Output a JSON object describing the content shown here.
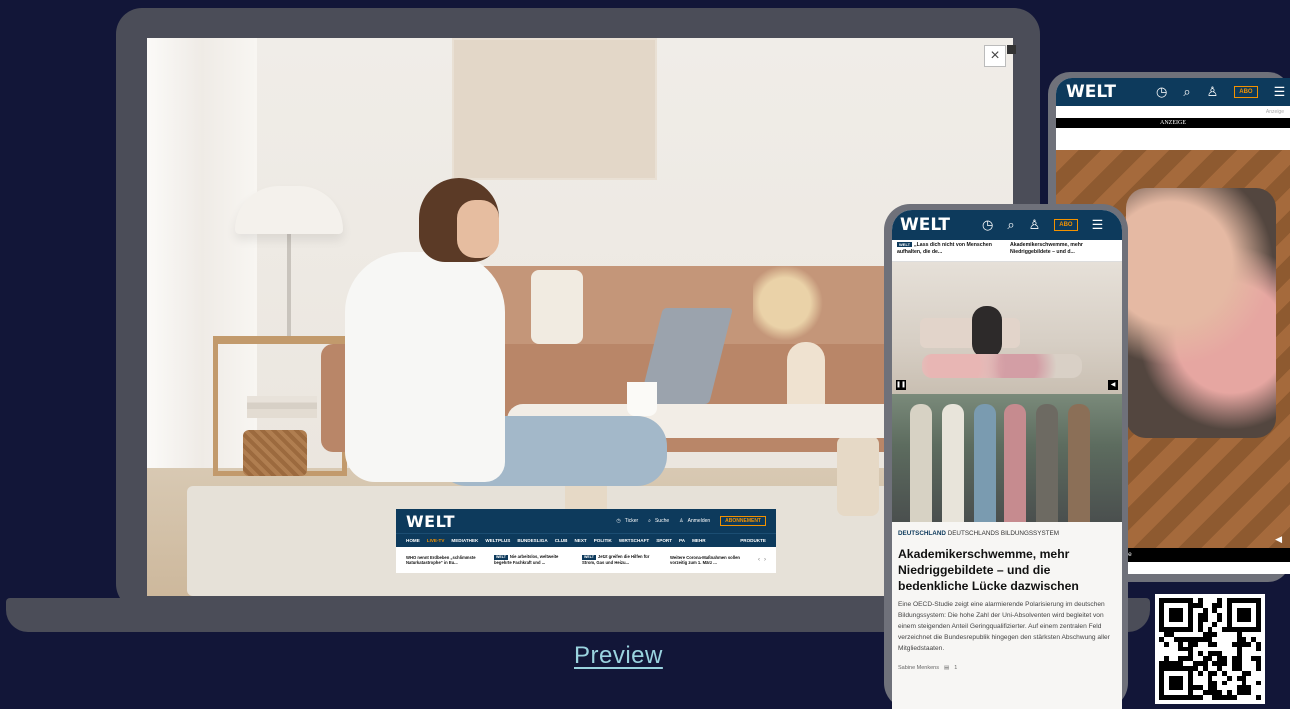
{
  "laptop": {
    "close_label": "×",
    "embed": {
      "logo": "WELT",
      "ticker": "Ticker",
      "search": "Suche",
      "login": "Anmelden",
      "abo": "ABONNEMENT",
      "nav": [
        "HOME",
        "LIVE-TV",
        "MEDIATHEK",
        "WELTPLUS",
        "BUNDESLIGA",
        "CLUB",
        "NEXT",
        "POLITIK",
        "WIRTSCHAFT",
        "SPORT",
        "PA",
        "MEHR"
      ],
      "products": "PRODUKTE",
      "news": [
        {
          "tag": "",
          "text": "WHO nennt Erdbeben „schlimmste Naturkatastrophe“ in Eu..."
        },
        {
          "tag": "WELT",
          "text": "Nie arbeitslos, weltweite begehrte Fachkraft und ..."
        },
        {
          "tag": "WELT",
          "text": "Jetzt greifen die Hilfen für Strom, Gas und Heizu..."
        },
        {
          "tag": "",
          "text": "Weitere Corona-Maßnahmen sollen vorzeitig zum 1. März ..."
        }
      ]
    }
  },
  "phone_back": {
    "logo": "WELT",
    "abo": "ABO",
    "anzeige_small": "Anzeige",
    "anzeige": "ANZEIGE",
    "footer": "weiter mit www.welt.de"
  },
  "phone_front": {
    "logo": "WELT",
    "abo": "ABO",
    "ticker": [
      {
        "tag": "WELT",
        "text": "„Lass dich nicht von Menschen aufhalten, die de..."
      },
      {
        "tag": "",
        "text": "Akademikerschwemme, mehr Niedriggebildete – und d..."
      }
    ],
    "kicker_bold": "DEUTSCHLAND",
    "kicker_rest": "DEUTSCHLANDS BILDUNGSSYSTEM",
    "title": "Akademikerschwemme, mehr Niedriggebildete – und die bedenkliche Lücke dazwischen",
    "text": "Eine OECD-Studie zeigt eine alarmierende Polarisierung im deutschen Bildungssystem: Die hohe Zahl der Uni-Absolventen wird begleitet von einem steigenden Anteil Geringqualifizierter. Auf einem zentralen Feld verzeichnet die Bundesrepublik hingegen den stärksten Abschwung aller Mitgliedstaaten.",
    "author": "Sabine Menkens",
    "comments": "1"
  },
  "preview_label": "Preview",
  "colors": {
    "background": "#121638",
    "welt_blue": "#0d3a5c",
    "accent": "#f39200",
    "preview": "#9ad3df"
  }
}
